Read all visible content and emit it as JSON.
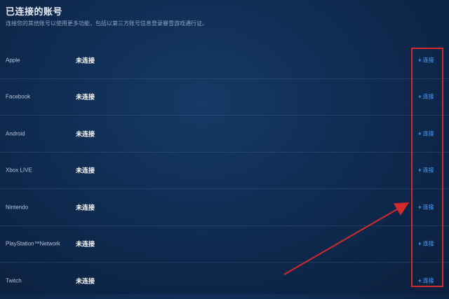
{
  "header": {
    "title": "已连接的账号",
    "subtitle": "连接您的其他账号以使用更多功能，包括以第三方账号信息登录暴雪游戏通行证。"
  },
  "accounts": [
    {
      "name": "Apple",
      "status": "未连接",
      "action": "连接"
    },
    {
      "name": "Facebook",
      "status": "未连接",
      "action": "连接"
    },
    {
      "name": "Android",
      "status": "未连接",
      "action": "连接"
    },
    {
      "name": "Xbox LIVE",
      "status": "未连接",
      "action": "连接"
    },
    {
      "name": "Nintendo",
      "status": "未连接",
      "action": "连接"
    },
    {
      "name": "PlayStation™Network",
      "status": "未连接",
      "action": "连接"
    },
    {
      "name": "Twitch",
      "status": "未连接",
      "action": "连接"
    }
  ],
  "icons": {
    "connect": "plus-icon"
  },
  "colors": {
    "background": "#0f2c52",
    "link": "#4da3ff",
    "annotation": "#d32b2b"
  }
}
